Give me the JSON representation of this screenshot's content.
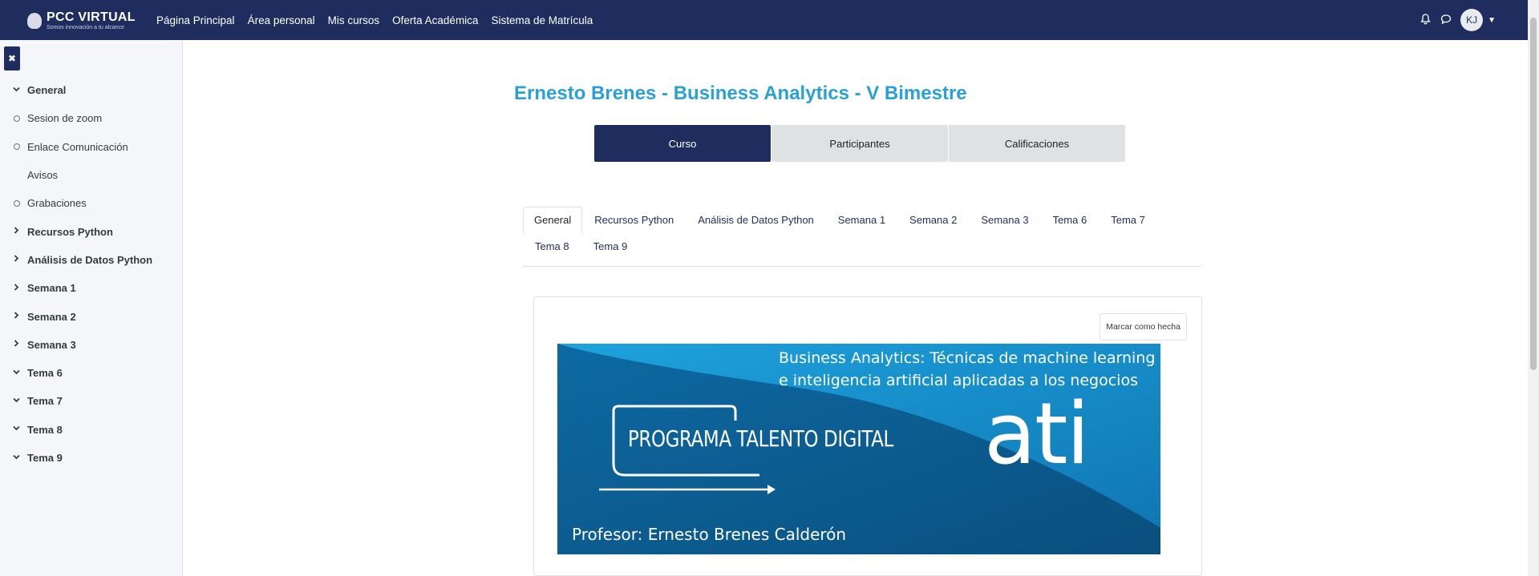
{
  "header": {
    "logo_title": "PCC VIRTUAL",
    "logo_subtitle": "Somos innovación a tu alcance",
    "nav": [
      "Página Principal",
      "Área personal",
      "Mis cursos",
      "Oferta Académica",
      "Sistema de Matrícula"
    ],
    "avatar_initials": "KJ",
    "icons": [
      "bell-icon",
      "chat-icon",
      "chevron-down-icon"
    ]
  },
  "sidebar": {
    "close_label": "✖",
    "items": [
      {
        "label": "General",
        "type": "section",
        "chevron": "down"
      },
      {
        "label": "Sesion de zoom",
        "type": "activity"
      },
      {
        "label": "Enlace Comunicación",
        "type": "activity"
      },
      {
        "label": "Avisos",
        "type": "plain"
      },
      {
        "label": "Grabaciones",
        "type": "activity"
      },
      {
        "label": "Recursos Python",
        "type": "section",
        "chevron": "right"
      },
      {
        "label": "Análisis de Datos Python",
        "type": "section",
        "chevron": "right"
      },
      {
        "label": "Semana 1",
        "type": "section",
        "chevron": "right"
      },
      {
        "label": "Semana 2",
        "type": "section",
        "chevron": "right"
      },
      {
        "label": "Semana 3",
        "type": "section",
        "chevron": "right"
      },
      {
        "label": "Tema 6",
        "type": "section",
        "chevron": "down"
      },
      {
        "label": "Tema 7",
        "type": "section",
        "chevron": "down"
      },
      {
        "label": "Tema 8",
        "type": "section",
        "chevron": "down"
      },
      {
        "label": "Tema 9",
        "type": "section",
        "chevron": "down"
      }
    ]
  },
  "main": {
    "course_title": "Ernesto Brenes - Business Analytics - V Bimestre",
    "secondary_nav": [
      "Curso",
      "Participantes",
      "Calificaciones"
    ],
    "section_tabs_row1": [
      "General",
      "Recursos Python",
      "Análisis de Datos Python",
      "Semana 1",
      "Semana 2",
      "Semana 3",
      "Tema 6",
      "Tema 7"
    ],
    "section_tabs_row2": [
      "Tema 8",
      "Tema 9"
    ],
    "mark_done_label": "Marcar como hecha",
    "banner": {
      "title": "Business Analytics: Técnicas de machine learning e inteligencia artificial aplicadas a los negocios",
      "program": "PROGRAMA TALENTO DIGITAL",
      "logo": "ati",
      "professor": "Profesor: Ernesto Brenes Calderón"
    }
  },
  "colors": {
    "header_bg": "#1e2d5e",
    "accent_title": "#2aa1d2",
    "banner_light": "#1a9ad6",
    "banner_dark": "#0d5c8c"
  }
}
